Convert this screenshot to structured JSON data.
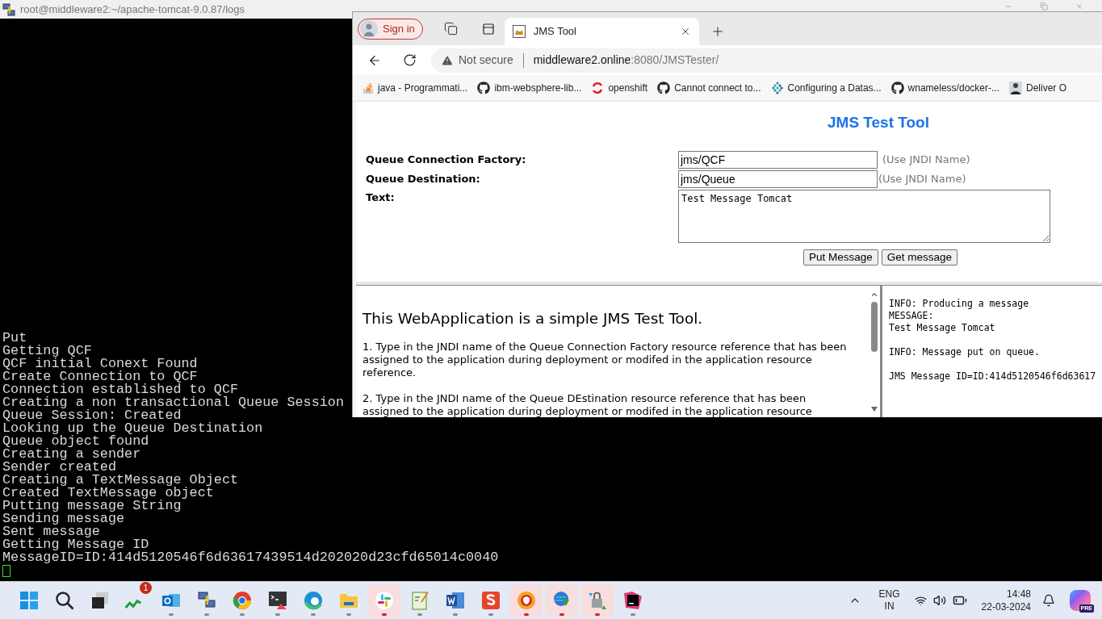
{
  "terminal": {
    "title": "root@middleware2:~/apache-tomcat-9.0.87/logs",
    "lines": [
      "Put",
      "Getting QCF",
      "QCF initial Conext Found",
      "Create Connection to QCF",
      "Connection established to QCF",
      "Creating a non transactional Queue Session",
      "Queue Session: Created",
      "Looking up the Queue Destination",
      "Queue object found",
      "Creating a sender",
      "Sender created",
      "Creating a TextMessage Object",
      "Created TextMessage object",
      "Putting message String",
      "Sending message",
      "Sent message",
      "Getting Message ID",
      "MessageID=ID:414d5120546f6d63617439514d202020d23cfd65014c0040"
    ]
  },
  "browser": {
    "profile": {
      "label": "Sign in"
    },
    "tabs": [
      {
        "title": "JMS Tool",
        "selected": true
      }
    ],
    "address": {
      "security": "Not secure",
      "host": "middleware2.online",
      "path": ":8080/JMSTester/"
    },
    "bookmarks": [
      {
        "label": "java - Programmati...",
        "kind": "stack"
      },
      {
        "label": "ibm-websphere-lib...",
        "kind": "github"
      },
      {
        "label": "openshift",
        "kind": "openshift"
      },
      {
        "label": "Cannot connect to...",
        "kind": "github"
      },
      {
        "label": "Configuring a Datas...",
        "kind": "dots"
      },
      {
        "label": "wnameless/docker-...",
        "kind": "github"
      },
      {
        "label": "Deliver O",
        "kind": "person"
      }
    ],
    "page": {
      "title": "JMS Test Tool",
      "fields": [
        {
          "label": "Queue Connection Factory:",
          "value": "jms/QCF",
          "hint": "(Use JNDI Name)"
        },
        {
          "label": "Queue Destination:",
          "value": "jms/Queue",
          "hint": "(Use JNDI Name)"
        }
      ],
      "text": {
        "label": "Text:",
        "value": "Test Message Tomcat"
      },
      "buttons": [
        "Put Message",
        "Get message"
      ],
      "help": {
        "heading": "This WebApplication is a simple JMS Test Tool.",
        "paragraphs": [
          "1. Type in the JNDI name of the Queue Connection Factory resource reference that has been assigned to the application during deployment or modifed in the application resource reference.",
          "2. Type in the JNDI name of the Queue DEstination resource reference that has been assigned to the application during deployment or modifed in the application resource"
        ]
      },
      "output": [
        [
          "INFO: Producing a message",
          "MESSAGE:",
          "Test Message Tomcat"
        ],
        [
          "INFO: Message put on queue."
        ],
        [
          "JMS Message ID=ID:414d5120546f6d63617"
        ]
      ]
    }
  },
  "taskbar": {
    "apps": [
      {
        "kind": "start",
        "running": false,
        "highlighted": false
      },
      {
        "kind": "search",
        "running": false,
        "highlighted": false
      },
      {
        "kind": "taskview",
        "running": false,
        "highlighted": false
      },
      {
        "kind": "chart",
        "running": false,
        "highlighted": false,
        "badge": "1"
      },
      {
        "kind": "mail",
        "running": true,
        "highlighted": false
      },
      {
        "kind": "network",
        "running": true,
        "highlighted": false
      },
      {
        "kind": "browser",
        "running": true,
        "highlighted": false
      },
      {
        "kind": "terminal",
        "running": true,
        "highlighted": false
      },
      {
        "kind": "edge",
        "running": true,
        "highlighted": false
      },
      {
        "kind": "folder",
        "running": true,
        "highlighted": false
      },
      {
        "kind": "chat",
        "running": true,
        "highlighted": true
      },
      {
        "kind": "notepad",
        "running": true,
        "highlighted": false
      },
      {
        "kind": "word",
        "running": true,
        "highlighted": false
      },
      {
        "kind": "capture",
        "running": true,
        "highlighted": false
      },
      {
        "kind": "shield",
        "running": true,
        "highlighted": true
      },
      {
        "kind": "download",
        "running": true,
        "highlighted": true
      },
      {
        "kind": "lock",
        "running": true,
        "highlighted": true
      },
      {
        "kind": "ide",
        "running": true,
        "highlighted": false
      }
    ],
    "language": [
      "ENG",
      "IN"
    ],
    "time": "14:48",
    "date": "22-03-2024",
    "assistant_badge": "PRE"
  }
}
